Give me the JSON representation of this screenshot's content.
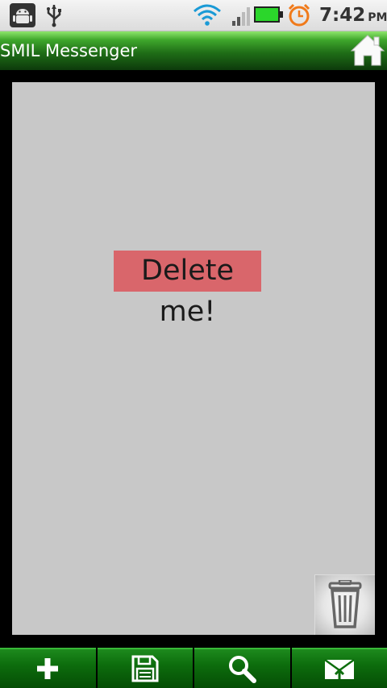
{
  "status_bar": {
    "icons": [
      "android-icon",
      "usb-icon",
      "wifi-icon",
      "signal-icon",
      "battery-icon",
      "alarm-icon"
    ],
    "time": "7:42",
    "ampm": "PM"
  },
  "app": {
    "title": "SMIL Messenger",
    "home_icon": "home-icon"
  },
  "canvas": {
    "background": "#c8c8c8",
    "item": {
      "text": "Delete me!",
      "background": "#d9666b"
    },
    "trash_icon": "trash-icon"
  },
  "toolbar": {
    "buttons": [
      {
        "icon": "add-icon"
      },
      {
        "icon": "save-icon"
      },
      {
        "icon": "search-icon"
      },
      {
        "icon": "send-mail-icon"
      }
    ],
    "accent": "#0d6d0d"
  }
}
